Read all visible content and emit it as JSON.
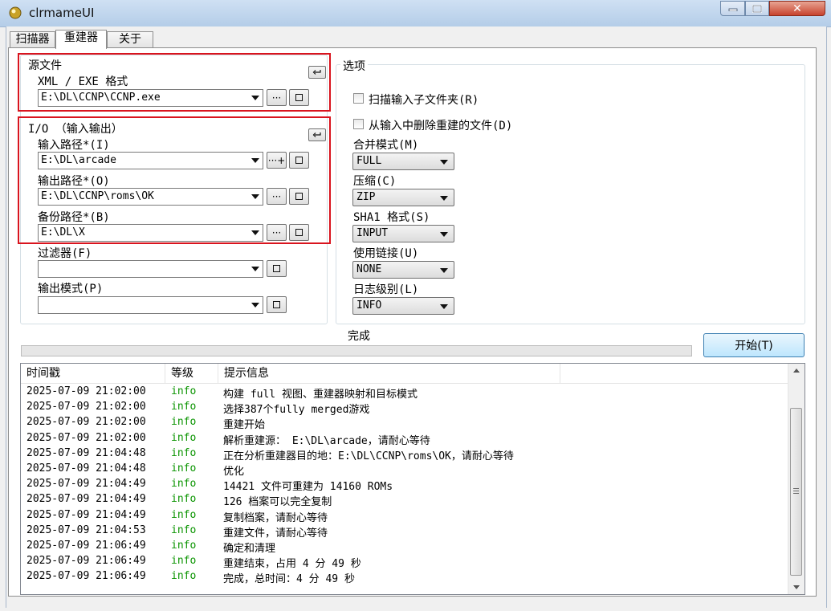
{
  "window": {
    "title": "clrmameUI",
    "minimize_icon": "minimize-icon",
    "maximize_icon": "maximize-icon",
    "close_icon": "close-icon"
  },
  "tabs": [
    {
      "label": "扫描器"
    },
    {
      "label": "重建器"
    },
    {
      "label": "关于"
    }
  ],
  "source_group": {
    "title": "源文件",
    "field_label": "XML / EXE 格式",
    "value": "E:\\DL\\CCNP\\CCNP.exe",
    "browse_label": "···"
  },
  "io_group": {
    "title": "I/O （输入输出）",
    "input_label": "输入路径*(I)",
    "input_value": "E:\\DL\\arcade",
    "input_browse_label": "···+",
    "output_label": "输出路径*(O)",
    "output_value": "E:\\DL\\CCNP\\roms\\OK",
    "output_browse_label": "···",
    "backup_label": "备份路径*(B)",
    "backup_value": "E:\\DL\\X",
    "backup_browse_label": "···",
    "filter_label": "过滤器(F)",
    "filter_value": "",
    "output_mode_label": "输出模式(P)",
    "output_mode_value": ""
  },
  "options": {
    "title": "选项",
    "scan_subfolders_label": "扫描输入子文件夹(R)",
    "scan_subfolders_checked": false,
    "remove_rebuilt_label": "从输入中删除重建的文件(D)",
    "remove_rebuilt_checked": false,
    "merge_mode_label": "合并模式(M)",
    "merge_mode_value": "FULL",
    "compress_label": "压缩(C)",
    "compress_value": "ZIP",
    "sha1_label": "SHA1 格式(S)",
    "sha1_value": "INPUT",
    "link_label": "使用链接(U)",
    "link_value": "NONE",
    "log_level_label": "日志级别(L)",
    "log_level_value": "INFO"
  },
  "status": {
    "text": "完成",
    "progress": 0
  },
  "start_button": "开始(T)",
  "log": {
    "columns": [
      "时间戳",
      "等级",
      "提示信息"
    ],
    "rows": [
      {
        "time": "2025-07-09 21:02:00",
        "level": "info",
        "message": "构建 full 视图、重建器映射和目标模式"
      },
      {
        "time": "2025-07-09 21:02:00",
        "level": "info",
        "message": "选择387个fully merged游戏"
      },
      {
        "time": "2025-07-09 21:02:00",
        "level": "info",
        "message": "重建开始"
      },
      {
        "time": "2025-07-09 21:02:00",
        "level": "info",
        "message": "解析重建源： E:\\DL\\arcade，请耐心等待"
      },
      {
        "time": "2025-07-09 21:04:48",
        "level": "info",
        "message": "正在分析重建器目的地：E:\\DL\\CCNP\\roms\\OK，请耐心等待"
      },
      {
        "time": "2025-07-09 21:04:48",
        "level": "info",
        "message": "优化"
      },
      {
        "time": "2025-07-09 21:04:49",
        "level": "info",
        "message": "14421 文件可重建为 14160 ROMs"
      },
      {
        "time": "2025-07-09 21:04:49",
        "level": "info",
        "message": "126 档案可以完全复制"
      },
      {
        "time": "2025-07-09 21:04:49",
        "level": "info",
        "message": "复制档案，请耐心等待"
      },
      {
        "time": "2025-07-09 21:04:53",
        "level": "info",
        "message": "重建文件，请耐心等待"
      },
      {
        "time": "2025-07-09 21:06:49",
        "level": "info",
        "message": "确定和清理"
      },
      {
        "time": "2025-07-09 21:06:49",
        "level": "info",
        "message": "重建结束，占用 4 分 49 秒"
      },
      {
        "time": "2025-07-09 21:06:49",
        "level": "info",
        "message": "完成，总时间：4 分 49 秒"
      }
    ]
  },
  "colors": {
    "highlight_border": "#d9141e",
    "info_level": "#0a9400",
    "start_button_border": "#3c7fb1"
  }
}
